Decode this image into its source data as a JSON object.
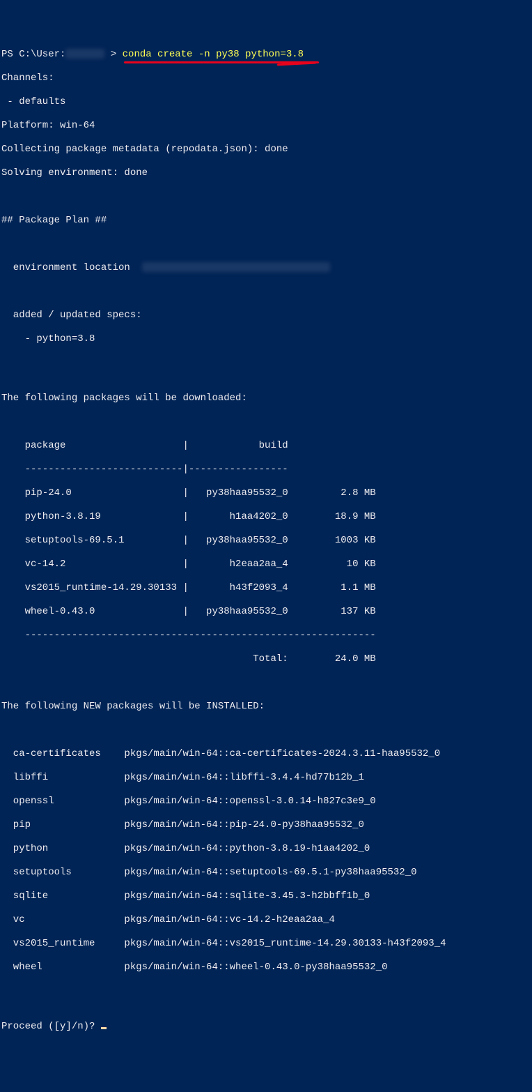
{
  "prompt": {
    "prefix": "PS C:\\User:",
    "gt": ">",
    "command": "conda create -n py38 python=3.8"
  },
  "headers": {
    "channels": "Channels:",
    "defaults": " - defaults",
    "platform": "Platform: win-64",
    "collecting": "Collecting package metadata (repodata.json): done",
    "solving": "Solving environment: done",
    "plan": "## Package Plan ##",
    "env_location": "  environment location",
    "added1": "  added / updated specs:",
    "added2": "    - python=3.8",
    "download_header": "The following packages will be downloaded:",
    "install_header": "The following NEW packages will be INSTALLED:",
    "proceed": "Proceed ([y]/n)? "
  },
  "table": {
    "header": "    package                    |            build",
    "rule1": "    ---------------------------|-----------------",
    "rows": [
      "    pip-24.0                   |   py38haa95532_0         2.8 MB",
      "    python-3.8.19              |       h1aa4202_0        18.9 MB",
      "    setuptools-69.5.1          |   py38haa95532_0        1003 KB",
      "    vc-14.2                    |       h2eaa2aa_4          10 KB",
      "    vs2015_runtime-14.29.30133 |       h43f2093_4         1.1 MB",
      "    wheel-0.43.0               |   py38haa95532_0         137 KB"
    ],
    "rule2": "    ------------------------------------------------------------",
    "total": "                                           Total:        24.0 MB"
  },
  "install": [
    "  ca-certificates    pkgs/main/win-64::ca-certificates-2024.3.11-haa95532_0",
    "  libffi             pkgs/main/win-64::libffi-3.4.4-hd77b12b_1",
    "  openssl            pkgs/main/win-64::openssl-3.0.14-h827c3e9_0",
    "  pip                pkgs/main/win-64::pip-24.0-py38haa95532_0",
    "  python             pkgs/main/win-64::python-3.8.19-h1aa4202_0",
    "  setuptools         pkgs/main/win-64::setuptools-69.5.1-py38haa95532_0",
    "  sqlite             pkgs/main/win-64::sqlite-3.45.3-h2bbff1b_0",
    "  vc                 pkgs/main/win-64::vc-14.2-h2eaa2aa_4",
    "  vs2015_runtime     pkgs/main/win-64::vs2015_runtime-14.29.30133-h43f2093_4",
    "  wheel              pkgs/main/win-64::wheel-0.43.0-py38haa95532_0"
  ]
}
